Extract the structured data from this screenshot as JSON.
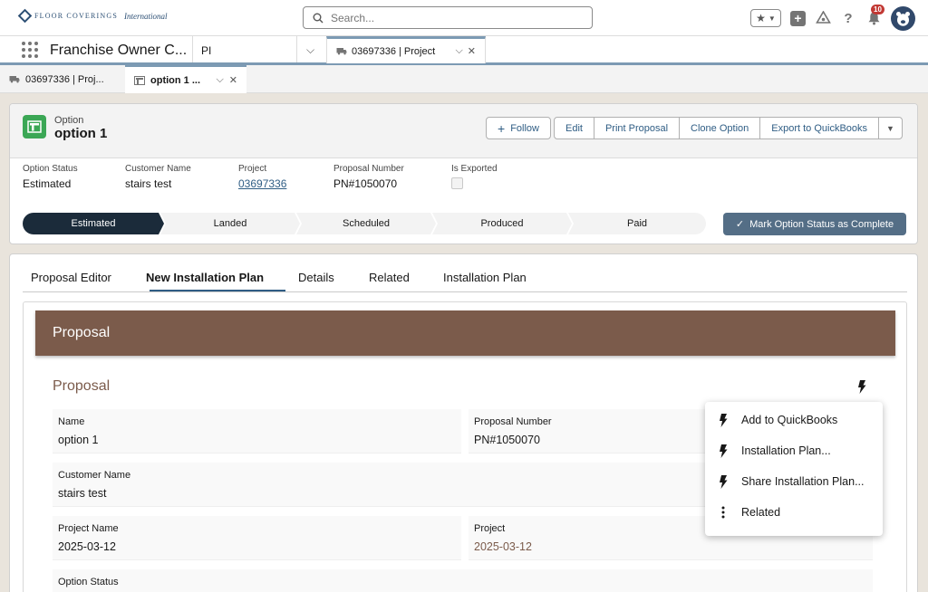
{
  "header": {
    "logo_text": "FLOOR COVERINGS",
    "logo_script": "International",
    "search_placeholder": "Search...",
    "notification_count": "10"
  },
  "app_nav": {
    "app_name": "Franchise Owner C...",
    "nav_item": "PI",
    "active_tab": "03697336 | Project"
  },
  "subtabs": [
    {
      "label": "03697336 | Proj..."
    },
    {
      "label": "option 1 ..."
    }
  ],
  "record": {
    "object_type": "Option",
    "name": "option 1",
    "actions": [
      "Follow",
      "Edit",
      "Print Proposal",
      "Clone Option",
      "Export to QuickBooks"
    ],
    "fields": [
      {
        "label": "Option Status",
        "value": "Estimated"
      },
      {
        "label": "Customer Name",
        "value": "stairs test"
      },
      {
        "label": "Project",
        "value": "03697336"
      },
      {
        "label": "Proposal Number",
        "value": "PN#1050070"
      },
      {
        "label": "Is Exported",
        "value": ""
      }
    ],
    "path_steps": [
      "Estimated",
      "Landed",
      "Scheduled",
      "Produced",
      "Paid"
    ],
    "current_step": "Estimated",
    "mark_complete_label": "Mark Option Status as Complete"
  },
  "tabs": [
    "Proposal Editor",
    "New Installation Plan",
    "Details",
    "Related",
    "Installation Plan"
  ],
  "active_tab": "New Installation Plan",
  "proposal": {
    "banner_title": "Proposal",
    "section_title": "Proposal",
    "rows": [
      {
        "label": "Name",
        "value": "option 1"
      },
      {
        "label": "Proposal Number",
        "value": "PN#1050070"
      },
      {
        "label": "Customer Name",
        "value": "stairs test"
      },
      {
        "label": "Project Name",
        "value": "2025-03-12"
      },
      {
        "label": "Project",
        "value": "2025-03-12"
      },
      {
        "label": "Option Status",
        "value": ""
      }
    ]
  },
  "menu": {
    "items": [
      {
        "label": "Add to QuickBooks",
        "icon": "lightning-icon"
      },
      {
        "label": "Installation Plan...",
        "icon": "lightning-icon"
      },
      {
        "label": "Share Installation Plan...",
        "icon": "lightning-icon"
      },
      {
        "label": "Related",
        "icon": "more-vertical-icon"
      }
    ]
  },
  "colors": {
    "accent": "#2f5d84",
    "brand_brown": "#7b5b4b",
    "path_current": "#1b2b3a",
    "record_icon": "#3ba755"
  }
}
